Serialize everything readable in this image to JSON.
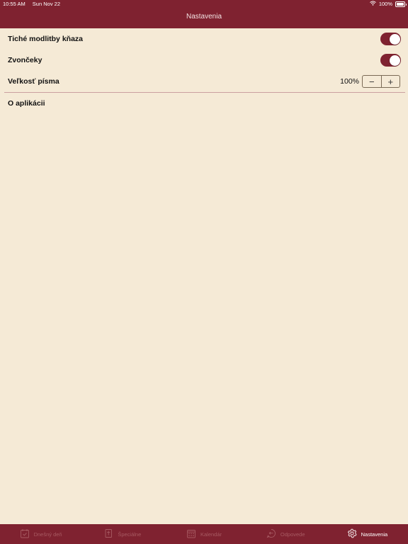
{
  "status_bar": {
    "time": "10:55 AM",
    "date": "Sun Nov 22",
    "battery": "100%"
  },
  "header": {
    "title": "Nastavenia"
  },
  "settings": {
    "silent_prayers": {
      "label": "Tiché modlitby kňaza",
      "enabled": true
    },
    "bells": {
      "label": "Zvončeky",
      "enabled": true
    },
    "font_size": {
      "label": "Veľkosť písma",
      "value": "100%",
      "decrease": "−",
      "increase": "+"
    },
    "about": {
      "label": "O aplikácii"
    }
  },
  "tabs": [
    {
      "label": "Dnešný deň",
      "icon": "calendar-check-icon",
      "active": false
    },
    {
      "label": "Špeciálne",
      "icon": "book-cross-icon",
      "active": false
    },
    {
      "label": "Kalendár",
      "icon": "calendar-grid-icon",
      "active": false
    },
    {
      "label": "Odpovede",
      "icon": "reply-bubble-icon",
      "active": false
    },
    {
      "label": "Nastavenia",
      "icon": "gear-icon",
      "active": true
    }
  ],
  "colors": {
    "accent": "#7f2230",
    "background": "#f5ead6"
  }
}
